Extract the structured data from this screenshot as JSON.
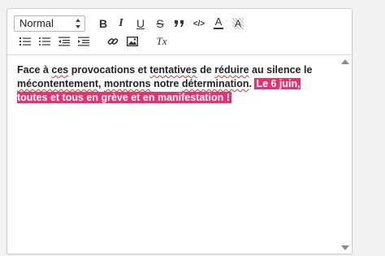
{
  "toolbar": {
    "format_select": {
      "value": "Normal"
    },
    "buttons_row1": [
      "bold-icon",
      "italic-icon",
      "underline-icon",
      "strikethrough-icon",
      "quote-icon",
      "code-icon",
      "font-color-icon",
      "background-color-icon"
    ],
    "buttons_row2": [
      "ordered-list-icon",
      "bullet-list-icon",
      "outdent-icon",
      "indent-icon",
      "link-icon",
      "image-icon",
      "clear-format-icon"
    ],
    "bold_glyph": "B",
    "italic_glyph": "I",
    "underline_glyph": "U",
    "strike_glyph": "S",
    "quote_glyph": "99",
    "code_glyph": "</>",
    "color_glyph": "A",
    "bg_glyph": "A",
    "clear_glyph": "Tx"
  },
  "content": {
    "p1": "Face à ",
    "w_ces": "ces",
    "p2": " provocations et ",
    "w_tentatives": "tentatives",
    "p3": " de ",
    "w_reduire": "réduire",
    "p4": " au silence le ",
    "w_mecontentement": "mécontentement",
    "p5": ", ",
    "w_montrons": "montrons",
    "p6": " notre ",
    "w_determination": "détermination",
    "p7": ". ",
    "highlight": "Le 6 juin, toutes et tous en grève et en manifestation !"
  },
  "colors": {
    "highlight_bg": "#e8326f",
    "highlight_text": "#ffffff"
  }
}
